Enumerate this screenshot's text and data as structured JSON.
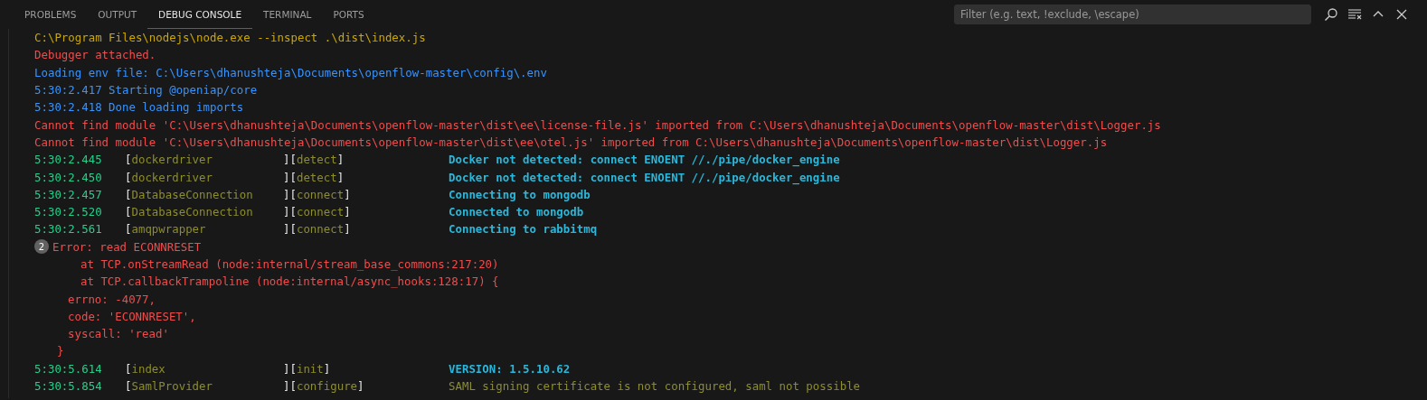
{
  "tabs": [
    {
      "label": "PROBLEMS",
      "selected": false
    },
    {
      "label": "OUTPUT",
      "selected": false
    },
    {
      "label": "DEBUG CONSOLE",
      "selected": true
    },
    {
      "label": "TERMINAL",
      "selected": false
    },
    {
      "label": "PORTS",
      "selected": false
    }
  ],
  "filter": {
    "placeholder": "Filter (e.g. text, !exclude, \\escape)"
  },
  "lines": [
    {
      "kind": "command",
      "text": "C:\\Program Files\\nodejs\\node.exe --inspect .\\dist\\index.js"
    },
    {
      "kind": "error",
      "text": "Debugger attached."
    },
    {
      "kind": "info",
      "text": "Loading env file: C:\\Users\\dhanushteja\\Documents\\openflow-master\\config\\.env"
    },
    {
      "kind": "info",
      "text": "5:30:2.417 Starting @openiap/core"
    },
    {
      "kind": "info",
      "text": "5:30:2.418 Done loading imports"
    },
    {
      "kind": "error",
      "text": "Cannot find module 'C:\\Users\\dhanushteja\\Documents\\openflow-master\\dist\\ee\\license-file.js' imported from C:\\Users\\dhanushteja\\Documents\\openflow-master\\dist\\Logger.js"
    },
    {
      "kind": "error",
      "text": "Cannot find module 'C:\\Users\\dhanushteja\\Documents\\openflow-master\\dist\\ee\\otel.js' imported from C:\\Users\\dhanushteja\\Documents\\openflow-master\\dist\\Logger.js"
    },
    {
      "kind": "log",
      "time": "5:30:2.445",
      "open": "[",
      "source": "dockerdriver",
      "mid": "][",
      "action": "detect",
      "close": "]",
      "message": "Docker not detected: connect ENOENT //./pipe/docker_engine"
    },
    {
      "kind": "log",
      "time": "5:30:2.450",
      "open": "[",
      "source": "dockerdriver",
      "mid": "][",
      "action": "detect",
      "close": "]",
      "message": "Docker not detected: connect ENOENT //./pipe/docker_engine"
    },
    {
      "kind": "log",
      "time": "5:30:2.457",
      "open": "[",
      "source": "DatabaseConnection",
      "mid": "][",
      "action": "connect",
      "close": "]",
      "message": "Connecting to mongodb"
    },
    {
      "kind": "log",
      "time": "5:30:2.520",
      "open": "[",
      "source": "DatabaseConnection",
      "mid": "][",
      "action": "connect",
      "close": "]",
      "message": "Connected to mongodb"
    },
    {
      "kind": "log",
      "time": "5:30:2.561",
      "open": "[",
      "source": "amqpwrapper",
      "mid": "][",
      "action": "connect",
      "close": "]",
      "message": "Connecting to rabbitmq"
    },
    {
      "kind": "exception",
      "count": "2",
      "text": "Error: read ECONNRESET"
    },
    {
      "kind": "stack",
      "text": "at TCP.onStreamRead (node:internal/stream_base_commons:217:20)"
    },
    {
      "kind": "stack",
      "text": "at TCP.callbackTrampoline (node:internal/async_hooks:128:17) {"
    },
    {
      "kind": "field",
      "text": "errno: -4077,"
    },
    {
      "kind": "field",
      "text": "code: 'ECONNRESET',"
    },
    {
      "kind": "field",
      "text": "syscall: 'read'"
    },
    {
      "kind": "closing",
      "text": "}"
    },
    {
      "kind": "log",
      "time": "5:30:5.614",
      "open": "[",
      "source": "index",
      "mid": "][",
      "action": "init",
      "close": "]",
      "message": "VERSION: 1.5.10.62"
    },
    {
      "kind": "log-dim",
      "time": "5:30:5.854",
      "open": "[",
      "source": "SamlProvider",
      "mid": "][",
      "action": "configure",
      "close": "]",
      "message": "SAML signing certificate is not configured, saml not possible"
    }
  ]
}
